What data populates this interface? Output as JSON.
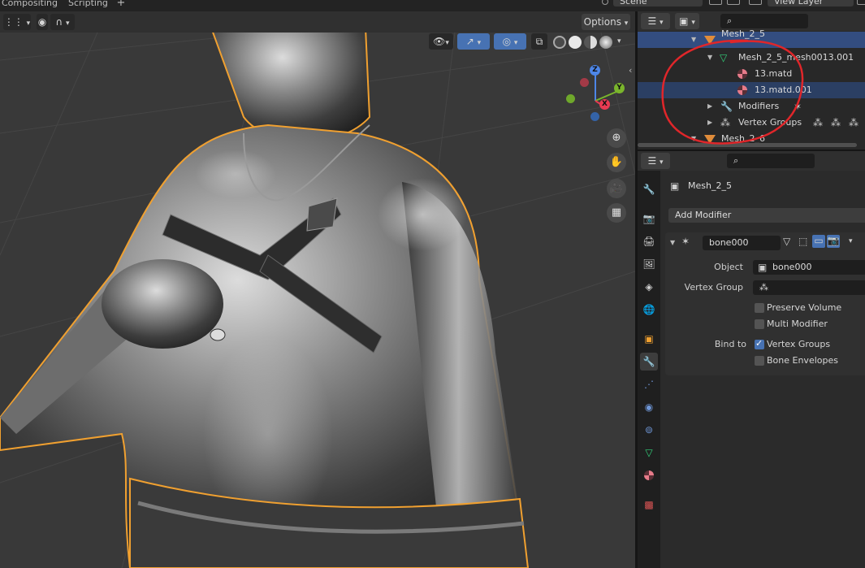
{
  "topbar": {
    "tabs": [
      "Compositing",
      "Scripting"
    ],
    "add_tab": "+",
    "scene": "Scene",
    "view_layer": "View Layer"
  },
  "viewport": {
    "options_label": "Options",
    "gizmo": {
      "z": "Z",
      "y": "Y",
      "x": "X"
    },
    "accent_color": "#f0a030"
  },
  "outliner": {
    "rows": [
      {
        "label": "Mesh_2_5",
        "kind": "object"
      },
      {
        "label": "Mesh_2_5_mesh0013.001",
        "kind": "mesh-data"
      },
      {
        "label": "13.matd",
        "kind": "material"
      },
      {
        "label": "13.matd.001",
        "kind": "material"
      },
      {
        "label": "Modifiers",
        "kind": "modifiers"
      },
      {
        "label": "Vertex Groups",
        "kind": "vertex-groups"
      },
      {
        "label": "Mesh_2_6",
        "kind": "object"
      }
    ]
  },
  "properties": {
    "object_name": "Mesh_2_5",
    "add_modifier": "Add Modifier",
    "modifier": {
      "name": "bone000",
      "object_label": "Object",
      "object_value": "bone000",
      "vertex_group_label": "Vertex Group",
      "vertex_group_value": "",
      "preserve_volume": {
        "label": "Preserve Volume",
        "checked": false
      },
      "multi_modifier": {
        "label": "Multi Modifier",
        "checked": false
      },
      "bind_to_label": "Bind to",
      "vertex_groups": {
        "label": "Vertex Groups",
        "checked": true
      },
      "bone_envelopes": {
        "label": "Bone Envelopes",
        "checked": false
      }
    }
  },
  "colors": {
    "selection_blue": "#334d80",
    "annotation_red": "#e0262a",
    "material_pink": "#e87b8a"
  }
}
